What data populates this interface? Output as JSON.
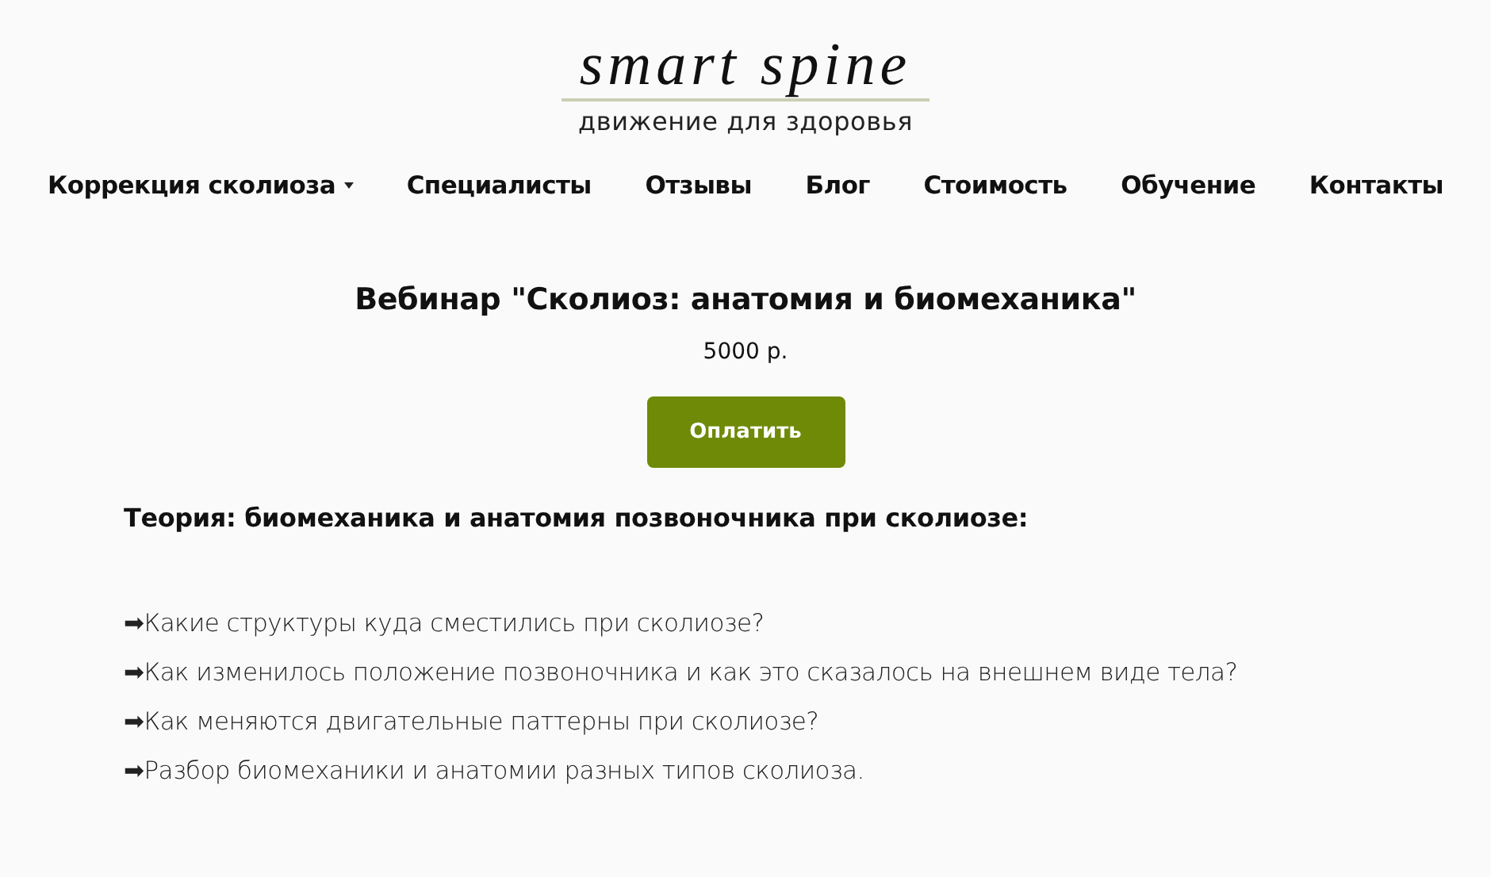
{
  "logo": {
    "wordmark": "smart spine",
    "tagline": "движение для здоровья"
  },
  "nav": [
    {
      "label": "Коррекция сколиоза",
      "has_dropdown": true
    },
    {
      "label": "Специалисты",
      "has_dropdown": false
    },
    {
      "label": "Отзывы",
      "has_dropdown": false
    },
    {
      "label": "Блог",
      "has_dropdown": false
    },
    {
      "label": "Стоимость",
      "has_dropdown": false
    },
    {
      "label": "Обучение",
      "has_dropdown": false
    },
    {
      "label": "Контакты",
      "has_dropdown": false
    }
  ],
  "product": {
    "title": "Вебинар \"Сколиоз: анатомия и биомеханика\"",
    "price": "5000 р.",
    "button": "Оплатить"
  },
  "section": {
    "heading": "Теория: биомеханика и анатомия позвоночника при сколиозе:",
    "items": [
      "➡Какие структуры куда сместились при сколиозе?",
      "➡Как изменилось положение позвоночника и как это сказалось на внешнем виде тела?",
      "➡Как меняются двигательные паттерны при сколиозе?",
      "➡Разбор биомеханики и анатомии разных типов сколиоза."
    ]
  }
}
